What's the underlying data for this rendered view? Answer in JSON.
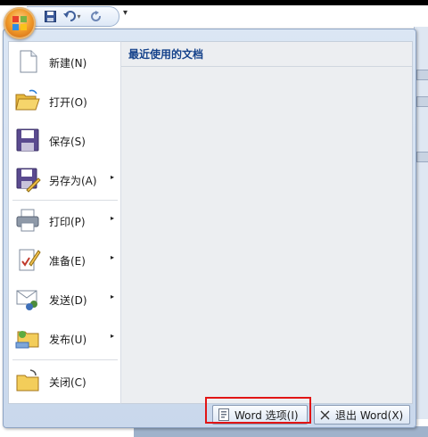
{
  "menu": {
    "items": [
      {
        "label": "新建(N)",
        "icon": "new-document-icon",
        "has_submenu": false
      },
      {
        "label": "打开(O)",
        "icon": "open-folder-icon",
        "has_submenu": false
      },
      {
        "label": "保存(S)",
        "icon": "save-icon",
        "has_submenu": false
      },
      {
        "label": "另存为(A)",
        "icon": "save-as-icon",
        "has_submenu": true
      },
      {
        "label": "打印(P)",
        "icon": "print-icon",
        "has_submenu": true
      },
      {
        "label": "准备(E)",
        "icon": "prepare-icon",
        "has_submenu": true
      },
      {
        "label": "发送(D)",
        "icon": "send-icon",
        "has_submenu": true
      },
      {
        "label": "发布(U)",
        "icon": "publish-icon",
        "has_submenu": true
      },
      {
        "label": "关闭(C)",
        "icon": "close-folder-icon",
        "has_submenu": false
      }
    ],
    "submenu_arrow": "▸"
  },
  "recent": {
    "title": "最近使用的文档"
  },
  "footer": {
    "options_label": "Word 选项(I)",
    "exit_label": "退出 Word(X)"
  },
  "qat": {
    "customize_glyph": "▾"
  },
  "colors": {
    "accent": "#15428b",
    "highlight": "#e11515",
    "panel_bg": "#dbe6f4"
  }
}
